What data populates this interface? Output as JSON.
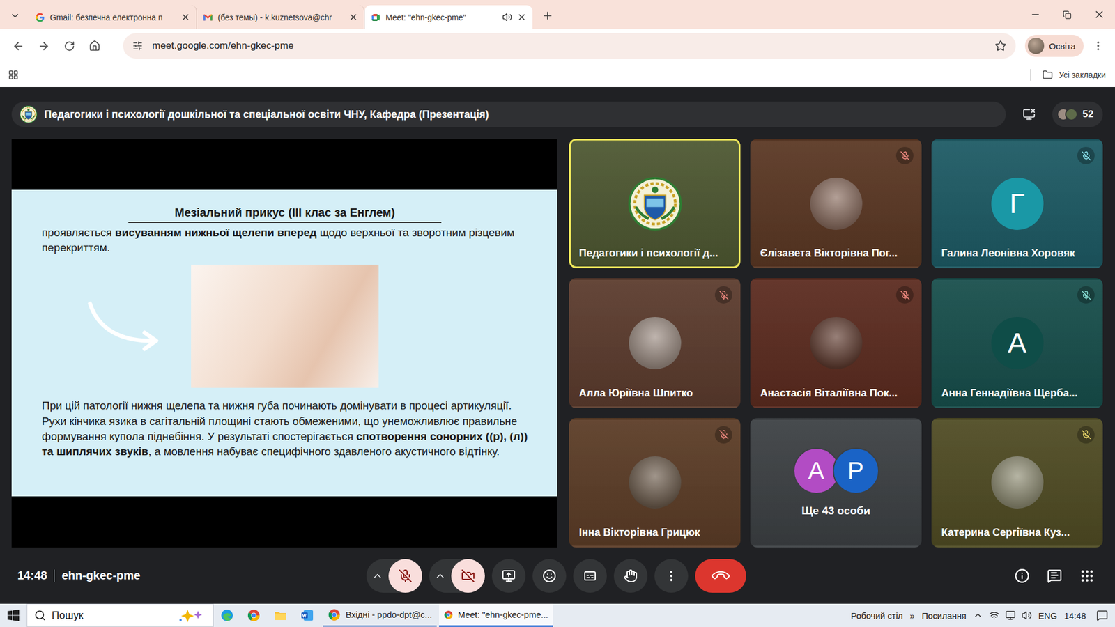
{
  "browser": {
    "tabs": [
      {
        "title": "Gmail: безпечна електронна п",
        "kind": "google",
        "selected": false,
        "audio": false
      },
      {
        "title": "(без темы) - k.kuznetsova@chr",
        "kind": "gmail",
        "selected": false,
        "audio": false
      },
      {
        "title": "Meet: \"ehn-gkec-pme\"",
        "kind": "meet",
        "selected": true,
        "audio": true
      }
    ],
    "address": "meet.google.com/ehn-gkec-pme",
    "profile": "Освіта",
    "bookmarks_label": "Усі закладки"
  },
  "meet": {
    "title": "Педагогики і психології дошкільної та спеціальної освіти ЧНУ, Кафедра (Презентація)",
    "participants_count": "52",
    "slide": {
      "title": "Мезіальний прикус (ІІІ клас за Енглем)",
      "intro": [
        {
          "text": "проявляється ",
          "bold": false
        },
        {
          "text": "висуванням нижньої щелепи вперед",
          "bold": true
        },
        {
          "text": " щодо верхньої та зворотним різцевим перекриттям.",
          "bold": false
        }
      ],
      "body": [
        {
          "text": "При цій патології нижня щелепа та нижня губа починають домінувати в процесі артикуляції. Рухи кінчика язика в сагітальній площині стають обмеженими, що унеможливлює правильне формування купола піднебіння. У результаті спостерігається ",
          "bold": false
        },
        {
          "text": "спотворення сонорних ((р), (л)) та шиплячих звуків",
          "bold": true
        },
        {
          "text": ", а мовлення набуває специфічного здавленого акустичного відтінку.",
          "bold": false
        }
      ]
    },
    "tiles": [
      {
        "name": "Педагогики і психології д...",
        "kind": "logo",
        "highlighted": true,
        "muted": false,
        "color": "#4d5731"
      },
      {
        "name": "Єлізавета Вікторівна Пог...",
        "kind": "photo",
        "highlighted": false,
        "muted": true,
        "color": "#5a3723",
        "avatar_color": "#8a6c5e",
        "mic_color": "#f28b82"
      },
      {
        "name": "Галина Леонівна Хоровяк",
        "kind": "letter",
        "letter": "Г",
        "highlighted": false,
        "muted": true,
        "color": "#1d5a64",
        "avatar_color": "#1a98a6",
        "mic_color": "#8ae0ec"
      },
      {
        "name": "Алла Юріївна Шпитко",
        "kind": "photo",
        "highlighted": false,
        "muted": true,
        "color": "#5b3b2d",
        "avatar_color": "#9c8c82",
        "mic_color": "#f28b82"
      },
      {
        "name": "Анастасія Віталіївна Пок...",
        "kind": "photo",
        "highlighted": false,
        "muted": true,
        "color": "#5b2b1f",
        "avatar_color": "#603b2f",
        "mic_color": "#f28b82"
      },
      {
        "name": "Анна Геннадіївна Щерба...",
        "kind": "letter",
        "letter": "А",
        "highlighted": false,
        "muted": true,
        "color": "#174e4b",
        "avatar_color": "#0f4d48",
        "mic_color": "#8ae0d6"
      },
      {
        "name": "Інна Вікторівна Грицюк",
        "kind": "photo",
        "highlighted": false,
        "muted": true,
        "color": "#5b3c26",
        "avatar_color": "#6d5c4c",
        "mic_color": "#f28b82"
      },
      {
        "name": "Ще 43 особи",
        "kind": "overflow",
        "highlighted": false,
        "muted": false,
        "color": "#3c4043",
        "avatars": [
          {
            "letter": "А",
            "color": "#b24cc4"
          },
          {
            "letter": "Р",
            "color": "#1a63c6"
          }
        ]
      },
      {
        "name": "Катерина Сергіївна Куз...",
        "kind": "photo",
        "highlighted": false,
        "muted": true,
        "color": "#4f4b23",
        "avatar_color": "#8e8c72",
        "mic_color": "#e8d66a"
      }
    ],
    "time": "14:48",
    "code": "ehn-gkec-pme",
    "controls": {
      "mic_muted": true,
      "camera_off": true
    }
  },
  "taskbar": {
    "search": "Пошук",
    "tasks": [
      {
        "title": "Вхідні - ppdo-dpt@c...",
        "selected": false
      },
      {
        "title": "Meet: \"ehn-gkec-pme...",
        "selected": true
      }
    ],
    "desktop": "Робочий стіл",
    "more": "»",
    "links": "Посилання",
    "language": "ENG",
    "clock": "14:48"
  }
}
